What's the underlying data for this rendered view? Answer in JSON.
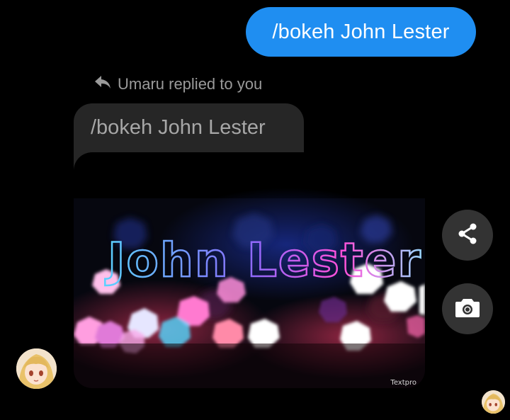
{
  "sent_message": {
    "text": "/bokeh John Lester",
    "color": "#1f8ef1"
  },
  "reply": {
    "label": "Umaru replied to you",
    "quoted_text": "/bokeh John Lester",
    "image_text": "John Lester",
    "watermark": "Textpro"
  },
  "actions": {
    "share_icon": "share-icon",
    "camera_icon": "camera-icon"
  },
  "avatars": {
    "sender": "sender-avatar",
    "read_receipt": "read-receipt-avatar"
  }
}
